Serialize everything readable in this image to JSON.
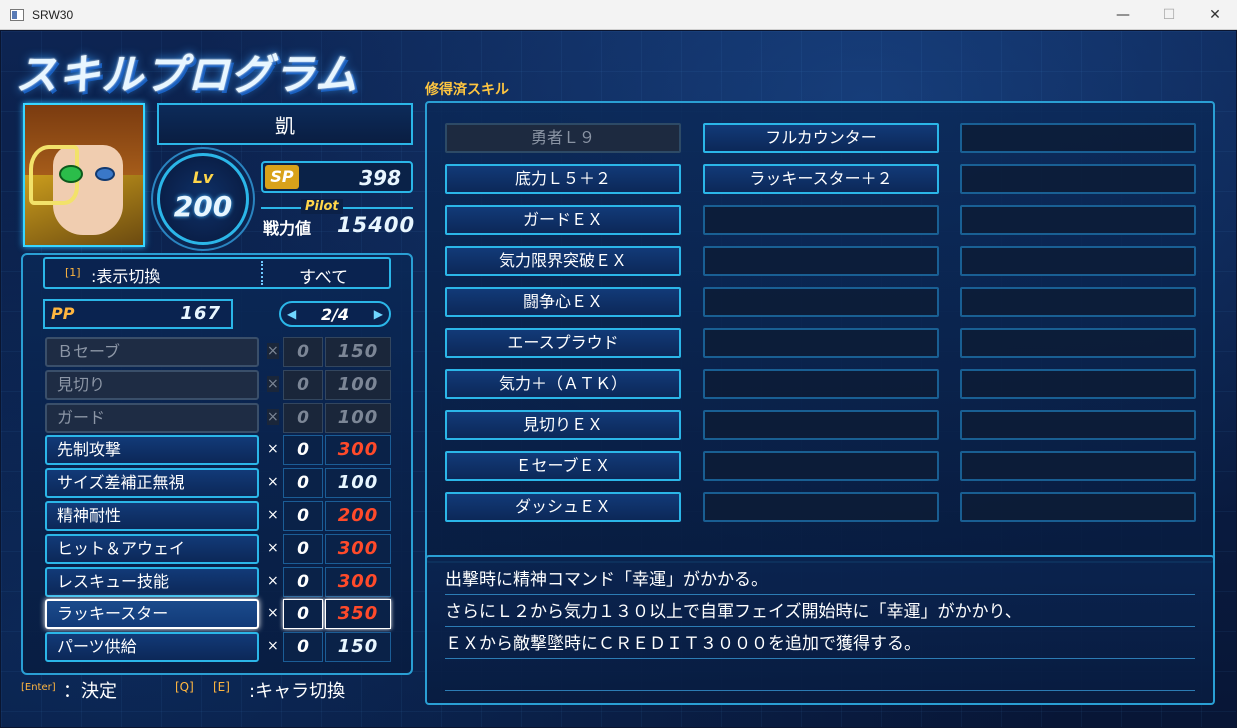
{
  "window": {
    "title": "SRW30"
  },
  "screen": {
    "title": "スキルプログラム"
  },
  "pilot": {
    "name": "凱",
    "lv_label": "Lv",
    "level": "200",
    "sp_label": "SP",
    "sp": "398",
    "pilot_tag": "Pilot",
    "power_label": "戦力値",
    "power": "15400"
  },
  "filter": {
    "key": "[1]",
    "label": ":表示切換",
    "value": "すべて"
  },
  "pp": {
    "label": "PP",
    "value": "167"
  },
  "pager": {
    "prev": "◀",
    "page": "2/4",
    "next": "▶"
  },
  "skills": [
    {
      "name": "Ｂセーブ",
      "x": "×",
      "count": "0",
      "cost": "150",
      "state": "disabled",
      "cost_color": "#7c8696"
    },
    {
      "name": "見切り",
      "x": "×",
      "count": "0",
      "cost": "100",
      "state": "disabled",
      "cost_color": "#7c8696"
    },
    {
      "name": "ガード",
      "x": "×",
      "count": "0",
      "cost": "100",
      "state": "disabled",
      "cost_color": "#7c8696"
    },
    {
      "name": "先制攻撃",
      "x": "×",
      "count": "0",
      "cost": "300",
      "state": "normal",
      "cost_color": "#ff4a2a"
    },
    {
      "name": "サイズ差補正無視",
      "x": "×",
      "count": "0",
      "cost": "100",
      "state": "normal",
      "cost_color": "#e8f6ff"
    },
    {
      "name": "精神耐性",
      "x": "×",
      "count": "0",
      "cost": "200",
      "state": "normal",
      "cost_color": "#ff4a2a"
    },
    {
      "name": "ヒット＆アウェイ",
      "x": "×",
      "count": "0",
      "cost": "300",
      "state": "normal",
      "cost_color": "#ff4a2a"
    },
    {
      "name": "レスキュー技能",
      "x": "×",
      "count": "0",
      "cost": "300",
      "state": "normal",
      "cost_color": "#ff4a2a"
    },
    {
      "name": "ラッキースター",
      "x": "×",
      "count": "0",
      "cost": "350",
      "state": "selected",
      "cost_color": "#ff4a2a"
    },
    {
      "name": "パーツ供給",
      "x": "×",
      "count": "0",
      "cost": "150",
      "state": "normal",
      "cost_color": "#e8f6ff"
    }
  ],
  "learned": {
    "title": "修得済スキル",
    "columns": [
      [
        "勇者Ｌ９",
        "底力Ｌ５＋２",
        "ガードＥＸ",
        "気力限界突破ＥＸ",
        "闘争心ＥＸ",
        "エースプラウド",
        "気力＋（ＡＴＫ）",
        "見切りＥＸ",
        "ＥセーブＥＸ",
        "ダッシュＥＸ"
      ],
      [
        "フルカウンター",
        "ラッキースター＋２",
        "",
        "",
        "",
        "",
        "",
        "",
        "",
        ""
      ],
      [
        "",
        "",
        "",
        "",
        "",
        "",
        "",
        "",
        "",
        ""
      ]
    ]
  },
  "description": [
    "出撃時に精神コマンド「幸運」がかかる。",
    "さらにＬ２から気力１３０以上で自軍フェイズ開始時に「幸運」がかかり、",
    "ＥＸから敵撃墜時にＣＲＥＤＩＴ３０００を追加で獲得する。"
  ],
  "footer": {
    "enter_key": "[Enter]",
    "enter_label": "：決定",
    "q_key": "[Q]",
    "e_key": "[E]",
    "switch_label": ":キャラ切換"
  }
}
